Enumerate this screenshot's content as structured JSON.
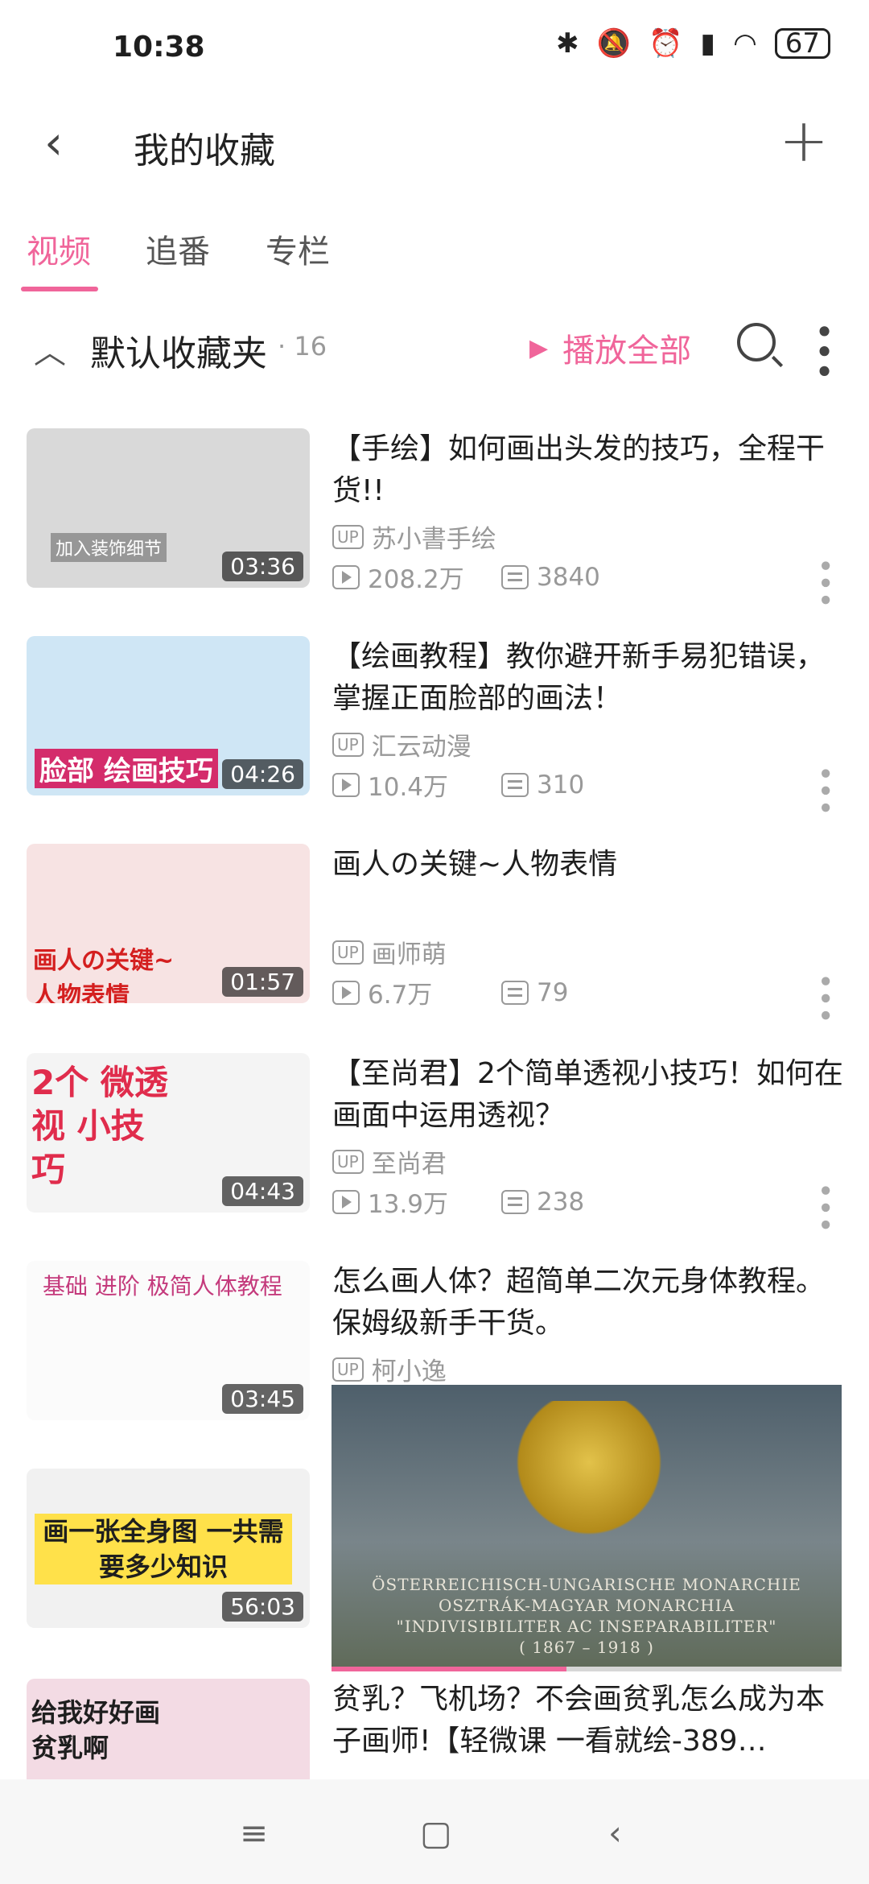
{
  "status_bar": {
    "time": "10:38",
    "battery": "67",
    "icons": [
      "bluetooth-icon",
      "mute-icon",
      "alarm-icon",
      "signal-icon",
      "wifi-icon",
      "battery-icon"
    ]
  },
  "header": {
    "title": "我的收藏"
  },
  "tabs": [
    {
      "label": "视频",
      "active": true
    },
    {
      "label": "追番",
      "active": false
    },
    {
      "label": "专栏",
      "active": false
    }
  ],
  "folder": {
    "name": "默认收藏夹",
    "count": "· 16",
    "play_all": "播放全部"
  },
  "items": [
    {
      "title": "【手绘】如何画出头发的技巧，全程干货!!",
      "up": "苏小書手绘",
      "views": "208.2万",
      "danmaku": "3840",
      "duration": "03:36",
      "thumb_text": "加入装饰细节",
      "thumb_color": "#d9d9d9"
    },
    {
      "title": "【绘画教程】教你避开新手易犯错误，掌握正面脸部的画法！",
      "up": "汇云动漫",
      "views": "10.4万",
      "danmaku": "310",
      "duration": "04:26",
      "thumb_text": "脸部 绘画技巧",
      "thumb_color": "#cfe6f5"
    },
    {
      "title": "画人の关键~人物表情",
      "up": "画师萌",
      "views": "6.7万",
      "danmaku": "79",
      "duration": "01:57",
      "thumb_text": "画人の关键~ 人物表情",
      "thumb_color": "#f7e3e3"
    },
    {
      "title": "【至尚君】2个简单透视小技巧！如何在画面中运用透视？",
      "up": "至尚君",
      "views": "13.9万",
      "danmaku": "238",
      "duration": "04:43",
      "thumb_text": "2个 微透视 小技巧",
      "thumb_color": "#f4f4f4"
    },
    {
      "title": "怎么画人体？超简单二次元身体教程。保姆级新手干货。",
      "up": "柯小逸",
      "duration": "03:45",
      "thumb_text": "基础 进阶 极简人体教程",
      "thumb_color": "#fbfbfb"
    },
    {
      "duration": "56:03",
      "thumb_text": "画一张全身图 一共需要多少知识",
      "thumb_color": "#f1f1f1"
    },
    {
      "title": "贫乳？飞机场？不会画贫乳怎么成为本子画师!【轻微课 一看就绘-389…",
      "thumb_text": "给我好好画 贫乳啊",
      "thumb_color": "#f3dbe4"
    }
  ],
  "floating_video": {
    "caption_lines": [
      "ÖSTERREICHISCH-UNGARISCHE MONARCHIE",
      "OSZTRÁK-MAGYAR MONARCHIA",
      "\"INDIVISIBILITER AC INSEPARABILITER\"",
      "( 1867 – 1918 )"
    ],
    "progress": 0.46
  },
  "nav": [
    "menu-icon",
    "home-icon",
    "back-icon"
  ]
}
